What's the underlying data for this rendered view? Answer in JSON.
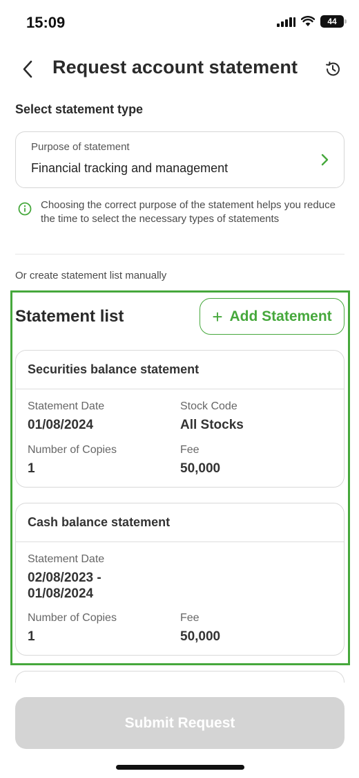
{
  "status_bar": {
    "time": "15:09",
    "battery": "44"
  },
  "header": {
    "title": "Request account statement",
    "back_icon": "chevron-left-icon",
    "history_icon": "history-icon"
  },
  "statement_type": {
    "section_title": "Select statement type",
    "purpose_label": "Purpose of statement",
    "purpose_value": "Financial tracking and management",
    "info_text": "Choosing the correct purpose of the statement helps you reduce the time to select the necessary types of statements"
  },
  "manual_text": "Or create statement list manually",
  "statement_list": {
    "title": "Statement list",
    "add_plus": "+",
    "add_label": "Add Statement",
    "cards": [
      {
        "title": "Securities balance statement",
        "date_label": "Statement Date",
        "date_value": "01/08/2024",
        "stock_label": "Stock Code",
        "stock_value": "All Stocks",
        "copies_label": "Number of Copies",
        "copies_value": "1",
        "fee_label": "Fee",
        "fee_value": "50,000"
      },
      {
        "title": "Cash balance statement",
        "date_label": "Statement Date",
        "date_value_line1": "02/08/2023 -",
        "date_value_line2": "01/08/2024",
        "copies_label": "Number of Copies",
        "copies_value": "1",
        "fee_label": "Fee",
        "fee_value": "50,000"
      }
    ]
  },
  "submit_label": "Submit Request",
  "colors": {
    "accent": "#46a83c",
    "disabled": "#d4d4d4",
    "text": "#2a2a2a"
  }
}
